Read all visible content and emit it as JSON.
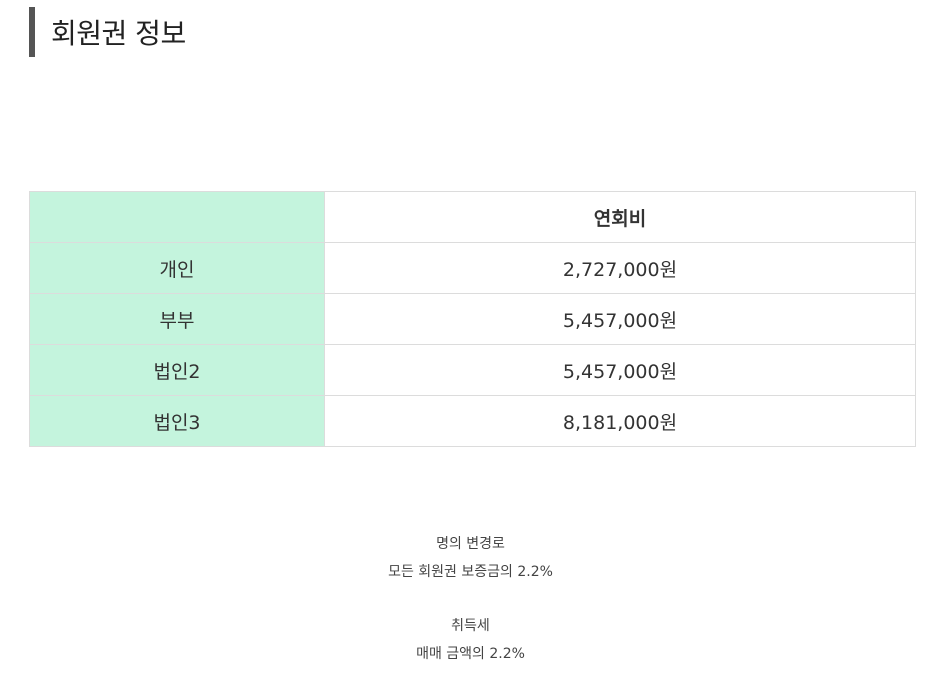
{
  "section": {
    "title": "회원권 정보"
  },
  "fee_table": {
    "header_empty": "",
    "header_fee": "연회비",
    "rows": [
      {
        "type": "개인",
        "fee": "2,727,000원"
      },
      {
        "type": "부부",
        "fee": "5,457,000원"
      },
      {
        "type": "법인2",
        "fee": "5,457,000원"
      },
      {
        "type": "법인3",
        "fee": "8,181,000원"
      }
    ]
  },
  "notes": {
    "transfer_label": "명의 변경로",
    "transfer_value": "모든 회원권 보증금의 2.2%",
    "acquisition_label": "취득세",
    "acquisition_value": "매매 금액의 2.2%"
  },
  "colors": {
    "label_bg": "#c4f4dd",
    "accent_bar": "#555555",
    "border": "#dcdcdc"
  }
}
